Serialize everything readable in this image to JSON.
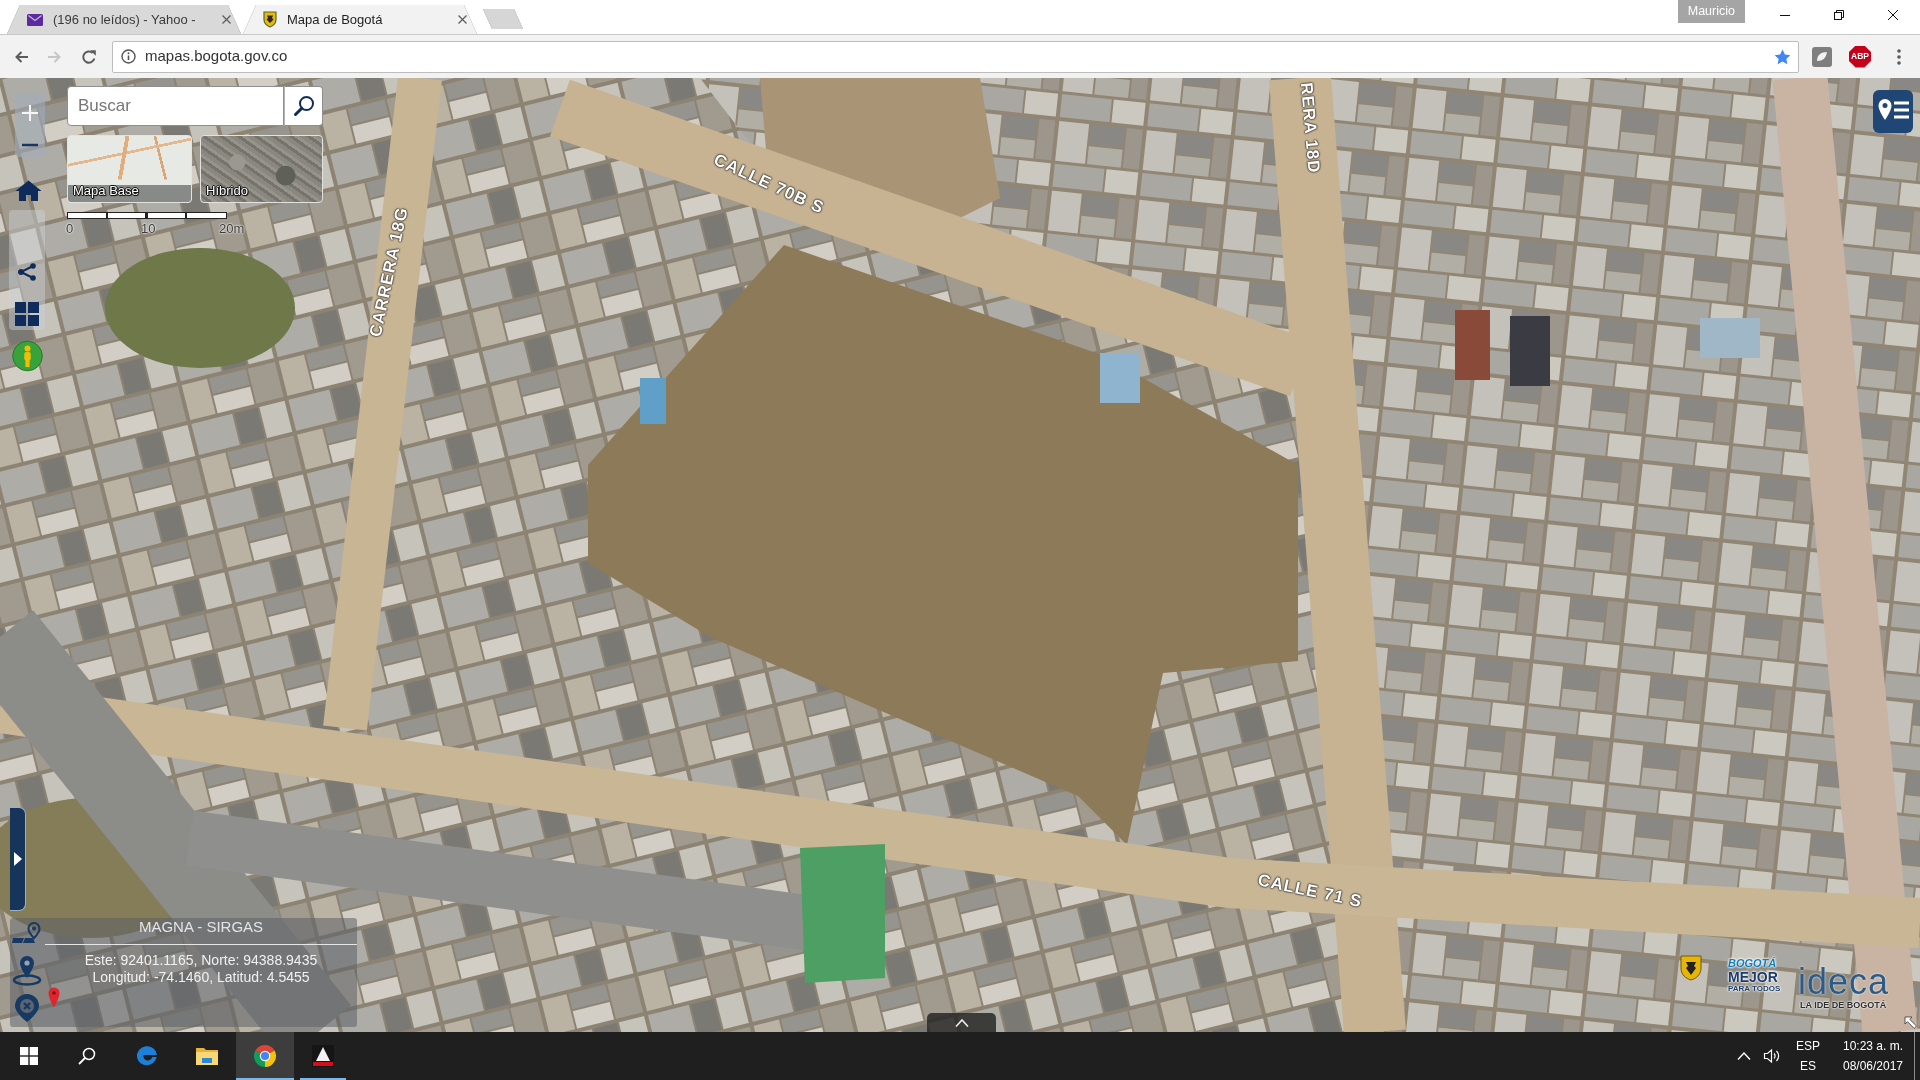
{
  "browser": {
    "tabs": [
      {
        "title": "(196 no leídos) - Yahoo -",
        "kind": "mail",
        "selected": false
      },
      {
        "title": "Mapa de Bogotá",
        "kind": "crest",
        "selected": true
      }
    ],
    "profile": "Mauricio",
    "nav": [
      {
        "kind": "back",
        "disabled": false
      },
      {
        "kind": "forward",
        "disabled": true
      },
      {
        "kind": "reload",
        "disabled": false
      }
    ],
    "address": "mapas.bogota.gov.co",
    "bookmarked": true,
    "extensions": [
      {
        "kind": "generic"
      },
      {
        "kind": "adblock",
        "label": "ABP"
      }
    ]
  },
  "map": {
    "search": {
      "placeholder": "Buscar"
    },
    "basemaps": [
      {
        "label": "Mapa Base",
        "kind": "streets"
      },
      {
        "label": "Híbrido",
        "kind": "aerial"
      }
    ],
    "scale_labels": [
      "0",
      "10",
      "20m"
    ],
    "street_labels": [
      "CALLE 70B S",
      "CARRERA 18G",
      "RERA 18D",
      "CALLE 71 S"
    ],
    "coordinates": {
      "system": "MAGNA - SIRGAS",
      "lines": [
        "Este: 92401.1165, Norte: 94388.9435",
        "Longitud: -74.1460, Latitud: 4.5455"
      ]
    },
    "logos": {
      "slogan": [
        "BOGOTÁ",
        "MEJOR",
        "PARA TODOS"
      ],
      "wordmark": "ideca",
      "tagline": "LA IDE DE BOGOTÁ"
    }
  },
  "taskbar": {
    "apps": [
      {
        "kind": "edge",
        "running": false,
        "selected": false
      },
      {
        "kind": "explorer",
        "running": false,
        "selected": false
      },
      {
        "kind": "chrome",
        "running": true,
        "selected": true
      },
      {
        "kind": "app",
        "running": true,
        "selected": false
      }
    ],
    "language": [
      "ESP",
      "ES"
    ],
    "time": "10:23 a. m.",
    "date": "08/06/2017"
  }
}
